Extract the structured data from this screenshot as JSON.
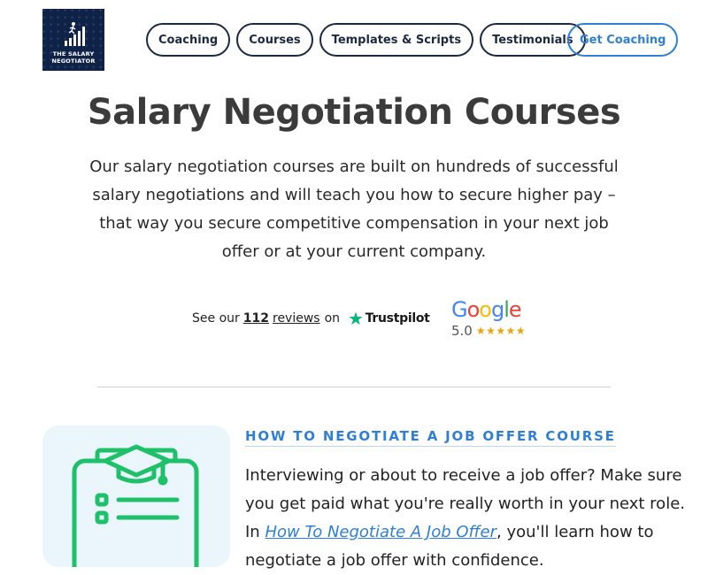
{
  "brand": {
    "logo_line1": "THE SALARY",
    "logo_line2": "NEGOTIATOR",
    "logo_bg": "#0f2248"
  },
  "nav": {
    "items": [
      "Coaching",
      "Courses",
      "Templates & Scripts",
      "Testimonials"
    ],
    "cta_label": "Get Coaching"
  },
  "hero": {
    "title": "Salary Negotiation Courses",
    "intro": "Our salary negotiation courses are built on hundreds of successful salary negotiations and will teach you how to secure higher pay – that way you secure competitive compensation in your next job offer or at your current company."
  },
  "reviews": {
    "prefix": "See our",
    "count": "112",
    "count_word": "reviews",
    "connector": "on",
    "platform": "Trustpilot",
    "google_word": "Google",
    "google_rating": "5.0",
    "google_stars": "★★★★★"
  },
  "course": {
    "title": "HOW TO NEGOTIATE A JOB OFFER COURSE",
    "desc_before": "Interviewing or about to receive a job offer? Make sure you get paid what you're really worth in your next role. In ",
    "desc_link": "How To Negotiate A Job Offer",
    "desc_after": ", you'll learn how to negotiate a job offer with confidence.",
    "icon": "clipboard-graduation-cap-icon"
  },
  "colors": {
    "accent": "#2f7fd6",
    "nav_border": "#1b2a41",
    "icon_green": "#1fc06a",
    "card_bg": "#eaf6fb"
  }
}
